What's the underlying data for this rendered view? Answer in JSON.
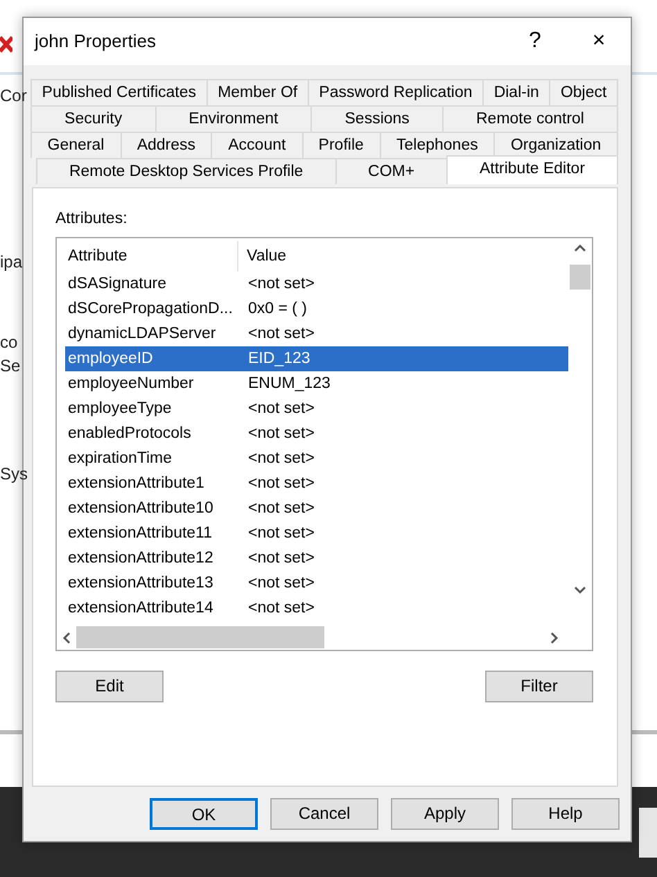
{
  "background_fragments": [
    "Cor",
    "ipa",
    "co",
    "Se",
    "Sys"
  ],
  "window": {
    "title": "john Properties",
    "help": "?",
    "close": "×"
  },
  "tab_rows": [
    [
      {
        "label": "Published Certificates",
        "selected": false
      },
      {
        "label": "Member Of",
        "selected": false
      },
      {
        "label": "Password Replication",
        "selected": false
      },
      {
        "label": "Dial-in",
        "selected": false
      },
      {
        "label": "Object",
        "selected": false
      }
    ],
    [
      {
        "label": "Security",
        "selected": false
      },
      {
        "label": "Environment",
        "selected": false
      },
      {
        "label": "Sessions",
        "selected": false
      },
      {
        "label": "Remote control",
        "selected": false
      }
    ],
    [
      {
        "label": "General",
        "selected": false
      },
      {
        "label": "Address",
        "selected": false
      },
      {
        "label": "Account",
        "selected": false
      },
      {
        "label": "Profile",
        "selected": false
      },
      {
        "label": "Telephones",
        "selected": false
      },
      {
        "label": "Organization",
        "selected": false
      }
    ],
    [
      {
        "label": "Remote Desktop Services Profile",
        "selected": false
      },
      {
        "label": "COM+",
        "selected": false
      },
      {
        "label": "Attribute Editor",
        "selected": true
      }
    ]
  ],
  "attributes_label": "Attributes:",
  "table": {
    "columns": [
      "Attribute",
      "Value"
    ],
    "rows": [
      {
        "attribute": "dSASignature",
        "value": "<not set>",
        "selected": false
      },
      {
        "attribute": "dSCorePropagationD...",
        "value": "0x0 = ( )",
        "selected": false
      },
      {
        "attribute": "dynamicLDAPServer",
        "value": "<not set>",
        "selected": false
      },
      {
        "attribute": "employeeID",
        "value": "EID_123",
        "selected": true
      },
      {
        "attribute": "employeeNumber",
        "value": "ENUM_123",
        "selected": false
      },
      {
        "attribute": "employeeType",
        "value": "<not set>",
        "selected": false
      },
      {
        "attribute": "enabledProtocols",
        "value": "<not set>",
        "selected": false
      },
      {
        "attribute": "expirationTime",
        "value": "<not set>",
        "selected": false
      },
      {
        "attribute": "extensionAttribute1",
        "value": "<not set>",
        "selected": false
      },
      {
        "attribute": "extensionAttribute10",
        "value": "<not set>",
        "selected": false
      },
      {
        "attribute": "extensionAttribute11",
        "value": "<not set>",
        "selected": false
      },
      {
        "attribute": "extensionAttribute12",
        "value": "<not set>",
        "selected": false
      },
      {
        "attribute": "extensionAttribute13",
        "value": "<not set>",
        "selected": false
      },
      {
        "attribute": "extensionAttribute14",
        "value": "<not set>",
        "selected": false
      }
    ]
  },
  "panel_buttons": [
    "Edit",
    "Filter"
  ],
  "dialog_buttons": [
    {
      "label": "OK",
      "default": true
    },
    {
      "label": "Cancel",
      "default": false
    },
    {
      "label": "Apply",
      "default": false
    },
    {
      "label": "Help",
      "default": false
    }
  ]
}
